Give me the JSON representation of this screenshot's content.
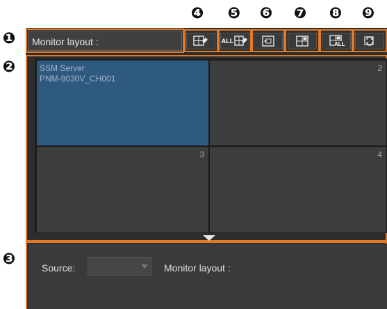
{
  "callouts": [
    "❶",
    "❷",
    "❸",
    "❹",
    "❺",
    "❻",
    "❼",
    "❽",
    "❾"
  ],
  "toolbar": {
    "label": "Monitor layout :",
    "buttons": [
      {
        "name": "layout-single-button",
        "icon": "layout-arrange-icon",
        "text": ""
      },
      {
        "name": "layout-all-button",
        "icon": "layout-arrange-all-icon",
        "text": "ALL"
      },
      {
        "name": "layout-swap-button",
        "icon": "layout-swap-icon",
        "text": ""
      },
      {
        "name": "layout-grid-button",
        "icon": "layout-grid-icon",
        "text": ""
      },
      {
        "name": "layout-grid-all-button",
        "icon": "layout-grid-all-icon",
        "text": "ALL"
      },
      {
        "name": "refresh-layout-button",
        "icon": "refresh-icon",
        "text": ""
      }
    ]
  },
  "grid": {
    "cells": [
      {
        "number": "",
        "line1": "SSM Server",
        "line2": "PNM-9030V_CH001",
        "selected": true
      },
      {
        "number": "2",
        "line1": "",
        "line2": "",
        "selected": false
      },
      {
        "number": "3",
        "line1": "",
        "line2": "",
        "selected": false
      },
      {
        "number": "4",
        "line1": "",
        "line2": "",
        "selected": false
      }
    ]
  },
  "bottom": {
    "source_label": "Source:",
    "source_value": "",
    "monitor_layout_label": "Monitor layout :"
  },
  "colors": {
    "accent": "#e07b2a",
    "selected_cell": "#2f5a80",
    "cell": "#3d3d3d",
    "background": "#2d2d2d"
  }
}
